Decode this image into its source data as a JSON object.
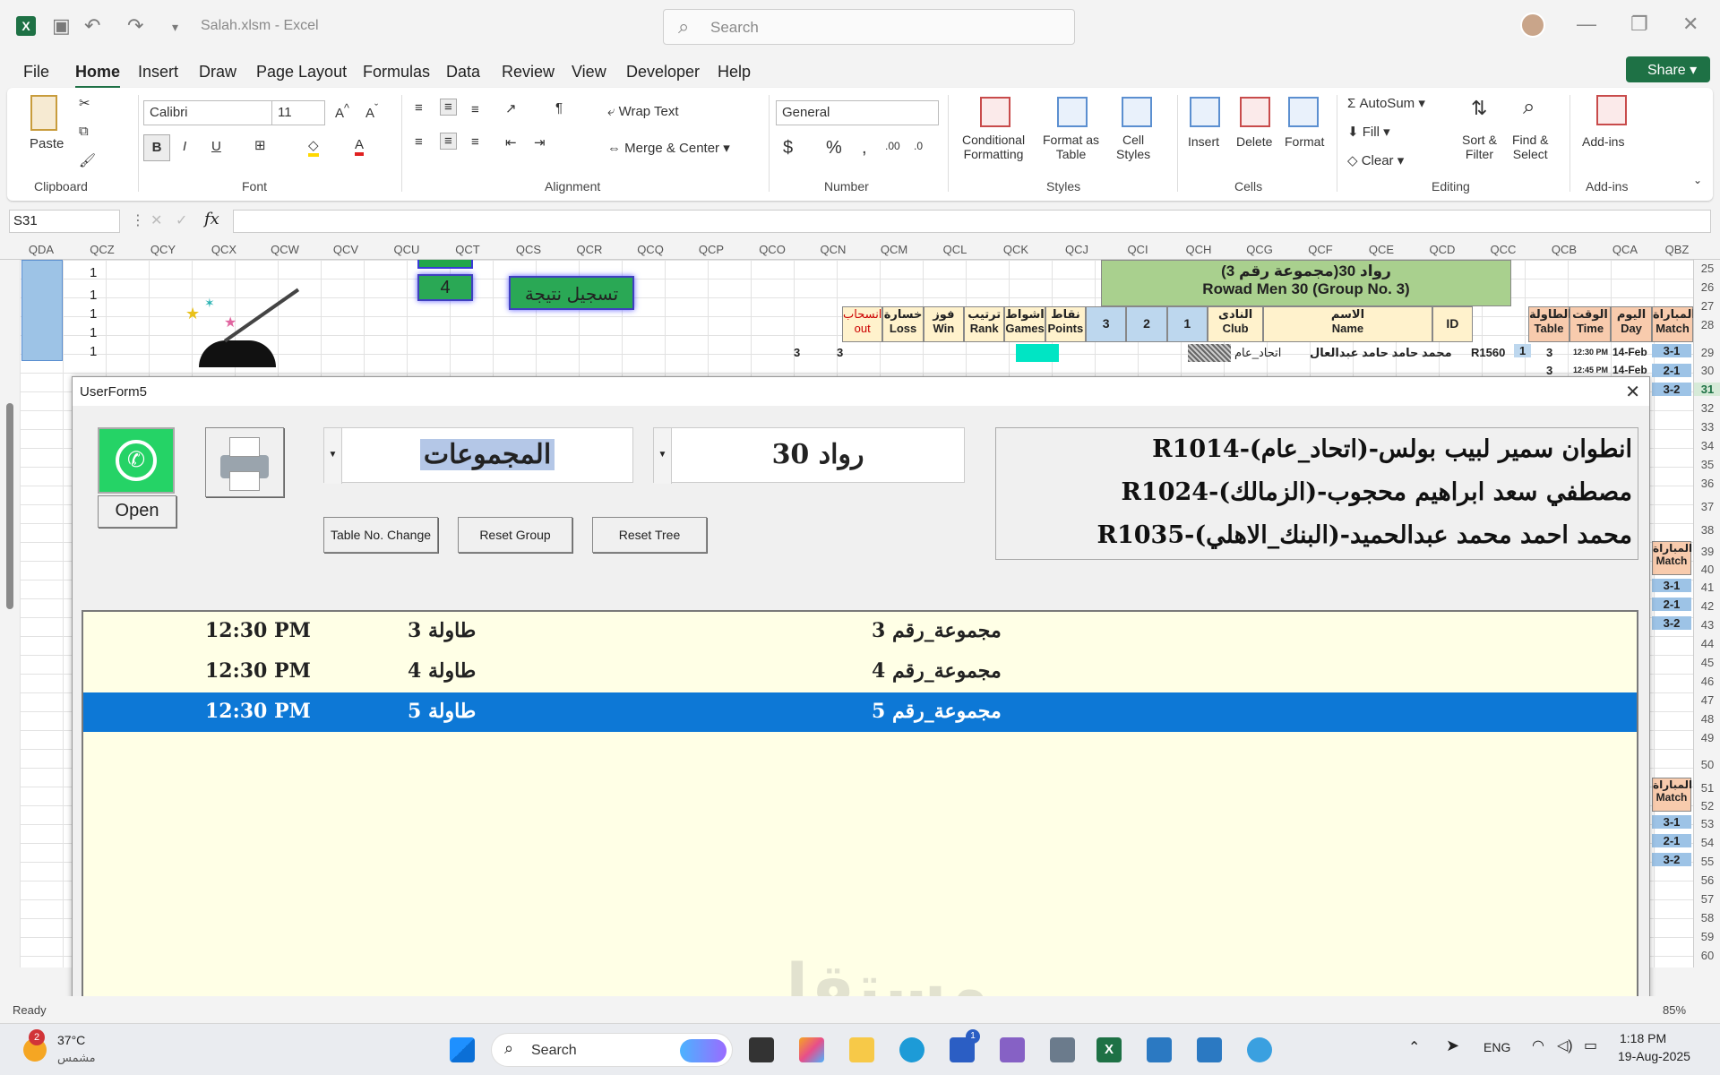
{
  "window": {
    "title": "Salah.xlsm  -  Excel",
    "search_placeholder": "Search"
  },
  "menu": [
    "File",
    "Home",
    "Insert",
    "Draw",
    "Page Layout",
    "Formulas",
    "Data",
    "Review",
    "View",
    "Developer",
    "Help"
  ],
  "share_label": "Share",
  "ribbon": {
    "paste": "Paste",
    "clipboard": "Clipboard",
    "font_name": "Calibri",
    "font_size": "11",
    "font_group": "Font",
    "wrap_text": "Wrap Text",
    "merge_center": "Merge & Center",
    "alignment": "Alignment",
    "number_format": "General",
    "number_group": "Number",
    "cond_format": "Conditional\nFormatting",
    "format_table": "Format as\nTable",
    "cell_styles": "Cell\nStyles",
    "styles_group": "Styles",
    "insert": "Insert",
    "delete": "Delete",
    "format": "Format",
    "cells_group": "Cells",
    "autosum": "AutoSum",
    "fill": "Fill",
    "clear": "Clear",
    "sort_filter": "Sort &\nFilter",
    "find_select": "Find &\nSelect",
    "editing_group": "Editing",
    "addins": "Add-ins",
    "addins_group": "Add-ins"
  },
  "name_box": "S31",
  "columns": [
    "QDA",
    "QCZ",
    "QCY",
    "QCX",
    "QCW",
    "QCV",
    "QCU",
    "QCT",
    "QCS",
    "QCR",
    "QCQ",
    "QCP",
    "QCO",
    "QCN",
    "QCM",
    "QCL",
    "QCK",
    "QCJ",
    "QCI",
    "QCH",
    "QCG",
    "QCF",
    "QCE",
    "QCD",
    "QCC",
    "QCB",
    "QCA",
    "QBZ"
  ],
  "rows": [
    "25",
    "26",
    "27",
    "28",
    "29",
    "30",
    "31",
    "32",
    "33",
    "34",
    "35",
    "36",
    "37",
    "38",
    "39",
    "40",
    "41",
    "42",
    "43",
    "44",
    "45",
    "46",
    "47",
    "48",
    "49",
    "50",
    "51",
    "52",
    "53",
    "54",
    "55",
    "56",
    "57",
    "58",
    "59",
    "60"
  ],
  "sheet": {
    "ones": [
      "1",
      "1",
      "1",
      "1",
      "1"
    ],
    "btn_number": "4",
    "btn_record": "تسجيل نتيجة",
    "group_title_ar": "رواد 30(مجموعة رقم 3)",
    "group_title_en": "Rowad Men 30 (Group No.  3)",
    "headers": [
      [
        "انسحاب",
        "out"
      ],
      [
        "خسارة",
        "Loss"
      ],
      [
        "فوز",
        "Win"
      ],
      [
        "ترتيب",
        "Rank"
      ],
      [
        "اشواط",
        "Games"
      ],
      [
        "نقاط",
        "Points"
      ],
      [
        "",
        "3"
      ],
      [
        "",
        "2"
      ],
      [
        "",
        "1"
      ],
      [
        "النادى",
        "Club"
      ],
      [
        "الاسم",
        "Name"
      ],
      [
        "",
        "ID"
      ]
    ],
    "right_headers": [
      [
        "الطاولة",
        "Table"
      ],
      [
        "الوقت",
        "Time"
      ],
      [
        "اليوم",
        "Day"
      ],
      [
        "المباراة",
        "Match"
      ]
    ],
    "row29": {
      "club": "اتحاد_عام",
      "name": "محمد حامد حامد عبدالعال",
      "id": "R1560",
      "num": "1",
      "table": "3",
      "time": "12:30 PM",
      "day": "14-Feb",
      "match": "3-1"
    },
    "row30": {
      "table": "3",
      "time": "12:45 PM",
      "day": "14-Feb",
      "match": "2-1"
    },
    "match_31": "3-2",
    "threes": [
      "3",
      "3"
    ],
    "match_hdr_ar": "المباراة",
    "match_hdr_en": "Match",
    "matches_b": [
      "3-1",
      "2-1",
      "3-2"
    ],
    "matches_c": [
      "3-1",
      "2-1",
      "3-2"
    ]
  },
  "userform": {
    "title": "UserForm5",
    "whatsapp_open": "Open",
    "combo_groups": "المجموعات",
    "combo_category": "رواد 30",
    "btn_table_change": "Table No. Change",
    "btn_reset_group": "Reset Group",
    "btn_reset_tree": "Reset Tree",
    "players": [
      "انطوان سمير لبيب بولس-(اتحاد_عام)-R1014",
      "مصطفي سعد ابراهيم محجوب-(الزمالك)-R1024",
      "محمد احمد محمد عبدالحميد-(البنك_الاهلي)-R1035"
    ],
    "list": [
      {
        "time": "12:30 PM",
        "table": "طاولة 3",
        "group": "مجموعة_رقم 3"
      },
      {
        "time": "12:30 PM",
        "table": "طاولة 4",
        "group": "مجموعة_رقم 4"
      },
      {
        "time": "12:30 PM",
        "table": "طاولة 5",
        "group": "مجموعة_رقم 5"
      }
    ]
  },
  "status": {
    "ready": "Ready",
    "zoom": "85%"
  },
  "taskbar": {
    "weather_temp": "37°C",
    "weather_desc": "مشمس",
    "badge": "2",
    "search": "Search",
    "lang": "ENG",
    "time": "1:18 PM",
    "date": "19-Aug-2025",
    "app_badge": "1"
  },
  "watermark": "مستقل"
}
